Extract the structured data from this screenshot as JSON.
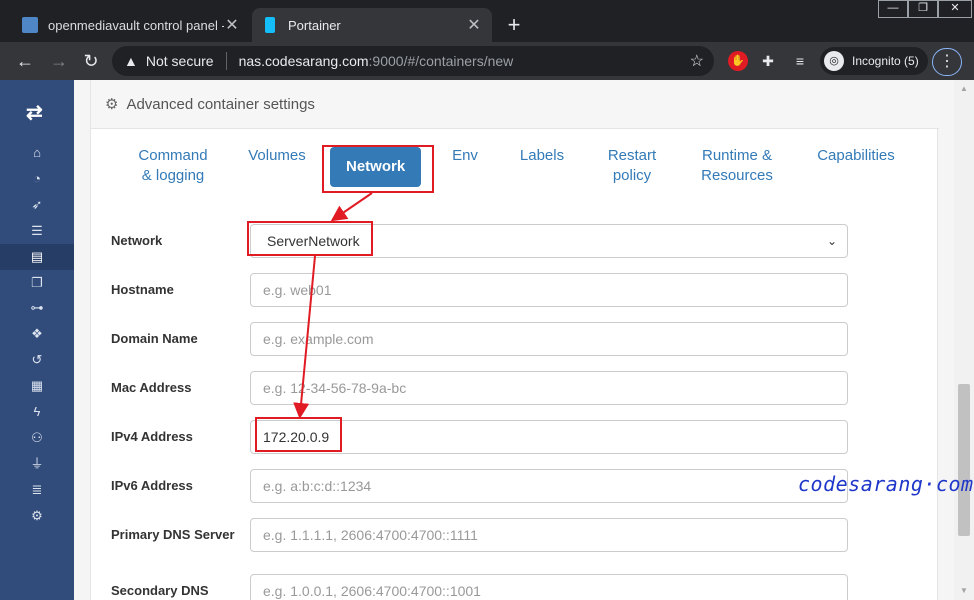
{
  "browser": {
    "tabs": [
      {
        "title": "openmediavault control panel - l",
        "favicon_color": "#4f86c6"
      },
      {
        "title": "Portainer",
        "favicon_color": "#13bef9"
      }
    ],
    "window_controls": [
      "—",
      "❐",
      "✕"
    ],
    "url": {
      "security": "Not secure",
      "host": "nas.codesarang.com",
      "rest": ":9000/#/containers/new"
    },
    "incognito_label": "Incognito (5)"
  },
  "sidebar": {
    "items": [
      {
        "icon": "home-icon",
        "glyph": "⌂"
      },
      {
        "icon": "dashboard-icon",
        "glyph": "◔"
      },
      {
        "icon": "rocket-icon",
        "glyph": "➶"
      },
      {
        "icon": "list-icon",
        "glyph": "☰"
      },
      {
        "icon": "server-icon",
        "glyph": "▤"
      },
      {
        "icon": "clone-icon",
        "glyph": "❐"
      },
      {
        "icon": "sitemap-icon",
        "glyph": "⊶"
      },
      {
        "icon": "cubes-icon",
        "glyph": "❖"
      },
      {
        "icon": "history-icon",
        "glyph": "↺"
      },
      {
        "icon": "grid-icon",
        "glyph": "▦"
      },
      {
        "icon": "bolt-icon",
        "glyph": "ϟ"
      },
      {
        "icon": "users-icon",
        "glyph": "⚇"
      },
      {
        "icon": "plug-icon",
        "glyph": "⏚"
      },
      {
        "icon": "database-icon",
        "glyph": "≣"
      },
      {
        "icon": "cogs-icon",
        "glyph": "⚙"
      }
    ],
    "active_index": 4
  },
  "panel": {
    "title": "Advanced container settings",
    "tabs": [
      {
        "label": "Command\n& logging"
      },
      {
        "label": "Volumes"
      },
      {
        "label": "Network"
      },
      {
        "label": "Env"
      },
      {
        "label": "Labels"
      },
      {
        "label": "Restart\npolicy"
      },
      {
        "label": "Runtime &\nResources"
      },
      {
        "label": "Capabilities"
      }
    ],
    "active_tab": "Network",
    "fields": [
      {
        "label": "Network",
        "value": "ServerNetwork",
        "placeholder": "",
        "type": "select"
      },
      {
        "label": "Hostname",
        "value": "",
        "placeholder": "e.g. web01",
        "type": "text"
      },
      {
        "label": "Domain Name",
        "value": "",
        "placeholder": "e.g. example.com",
        "type": "text"
      },
      {
        "label": "Mac Address",
        "value": "",
        "placeholder": "e.g. 12-34-56-78-9a-bc",
        "type": "text"
      },
      {
        "label": "IPv4 Address",
        "value": "172.20.0.9",
        "placeholder": "",
        "type": "text"
      },
      {
        "label": "IPv6 Address",
        "value": "",
        "placeholder": "e.g. a:b:c:d::1234",
        "type": "text"
      },
      {
        "label": "Primary DNS Server",
        "value": "",
        "placeholder": "e.g. 1.1.1.1, 2606:4700:4700::1111",
        "type": "text"
      },
      {
        "label": "Secondary DNS",
        "value": "",
        "placeholder": "e.g. 1.0.0.1, 2606:4700:4700::1001",
        "type": "text"
      }
    ]
  },
  "watermark": "codesarang·com",
  "colors": {
    "accent": "#337ab7",
    "sidebar": "#314b7a",
    "highlight": "#e01b24"
  }
}
